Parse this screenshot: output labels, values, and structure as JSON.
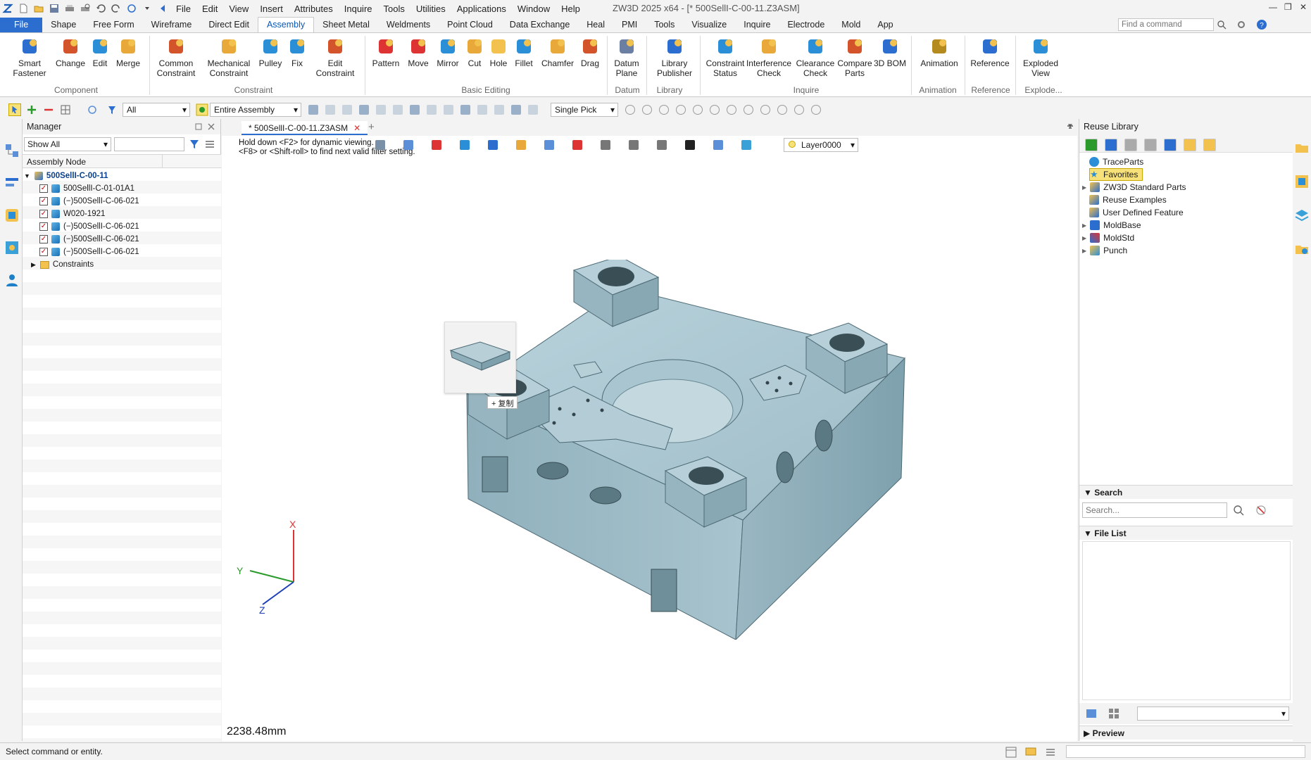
{
  "window": {
    "title": "ZW3D 2025 x64 - [* 500SellI-C-00-11.Z3ASM]"
  },
  "menu": [
    "File",
    "Edit",
    "View",
    "Insert",
    "Attributes",
    "Inquire",
    "Tools",
    "Utilities",
    "Applications",
    "Window",
    "Help"
  ],
  "ribbon_tabs": [
    "File",
    "Shape",
    "Free Form",
    "Wireframe",
    "Direct Edit",
    "Assembly",
    "Sheet Metal",
    "Weldments",
    "Point Cloud",
    "Data Exchange",
    "Heal",
    "PMI",
    "Tools",
    "Visualize",
    "Inquire",
    "Electrode",
    "Mold",
    "App"
  ],
  "active_tab": "Assembly",
  "command_search": {
    "placeholder": "Find a command"
  },
  "ribbon": {
    "buttons": [
      {
        "label": "Smart\nFastener",
        "icon": "smart-fastener-icon"
      },
      {
        "label": "Change",
        "icon": "change-icon"
      },
      {
        "label": "Edit",
        "icon": "edit-icon"
      },
      {
        "label": "Merge",
        "icon": "merge-icon"
      },
      {
        "label": "Common\nConstraint",
        "icon": "common-constraint-icon"
      },
      {
        "label": "Mechanical\nConstraint",
        "icon": "mechanical-constraint-icon"
      },
      {
        "label": "Pulley",
        "icon": "pulley-icon"
      },
      {
        "label": "Fix",
        "icon": "fix-icon"
      },
      {
        "label": "Edit\nConstraint",
        "icon": "edit-constraint-icon"
      },
      {
        "label": "Pattern",
        "icon": "pattern-icon"
      },
      {
        "label": "Move",
        "icon": "move-icon"
      },
      {
        "label": "Mirror",
        "icon": "mirror-icon"
      },
      {
        "label": "Cut",
        "icon": "cut-icon"
      },
      {
        "label": "Hole",
        "icon": "hole-icon"
      },
      {
        "label": "Fillet",
        "icon": "fillet-icon"
      },
      {
        "label": "Chamfer",
        "icon": "chamfer-icon"
      },
      {
        "label": "Drag",
        "icon": "drag-icon"
      },
      {
        "label": "Datum\nPlane",
        "icon": "datum-plane-icon"
      },
      {
        "label": "Library\nPublisher",
        "icon": "library-publisher-icon"
      },
      {
        "label": "Constraint\nStatus",
        "icon": "constraint-status-icon"
      },
      {
        "label": "Interference\nCheck",
        "icon": "interference-check-icon"
      },
      {
        "label": "Clearance\nCheck",
        "icon": "clearance-check-icon"
      },
      {
        "label": "Compare\nParts",
        "icon": "compare-parts-icon"
      },
      {
        "label": "3D BOM",
        "icon": "bom-icon"
      },
      {
        "label": "Animation",
        "icon": "animation-icon"
      },
      {
        "label": "Reference",
        "icon": "reference-icon"
      },
      {
        "label": "Exploded\nView",
        "icon": "exploded-view-icon"
      }
    ],
    "groups": [
      "Component",
      "Constraint",
      "Basic Editing",
      "Datum",
      "Library",
      "Inquire",
      "Animation",
      "Reference",
      "Explode..."
    ]
  },
  "toolbar": {
    "filter": "All",
    "scope": "Entire Assembly",
    "pick": "Single Pick"
  },
  "manager": {
    "title": "Manager",
    "filter": "Show All",
    "column": "Assembly Node",
    "root": "500SellI-C-00-11",
    "nodes": [
      "500SellI-C-01-01A1",
      "(−)500SellI-C-06-021",
      "W020-1921",
      "(−)500SellI-C-06-021",
      "(−)500SellI-C-06-021",
      "(−)500SellI-C-06-021"
    ],
    "constraints": "Constraints"
  },
  "viewport": {
    "doc_tab": "* 500SellI-C-00-11.Z3ASM",
    "hint1": "Hold down <F2> for dynamic viewing.",
    "hint2": "<F8> or <Shift-roll> to find next valid filter setting.",
    "layer": "Layer0000",
    "scale": "2238.48mm",
    "copy_tooltip": "+ 复制",
    "axis": {
      "x": "X",
      "y": "Y",
      "z": "Z"
    }
  },
  "reuse": {
    "title": "Reuse Library",
    "items": [
      "TraceParts",
      "Favorites",
      "ZW3D Standard Parts",
      "Reuse Examples",
      "User Defined Feature",
      "MoldBase",
      "MoldStd",
      "Punch"
    ],
    "search_title": "Search",
    "search_placeholder": "Search...",
    "filelist_title": "File List",
    "preview_title": "Preview"
  },
  "status": {
    "text": "Select command or entity."
  }
}
